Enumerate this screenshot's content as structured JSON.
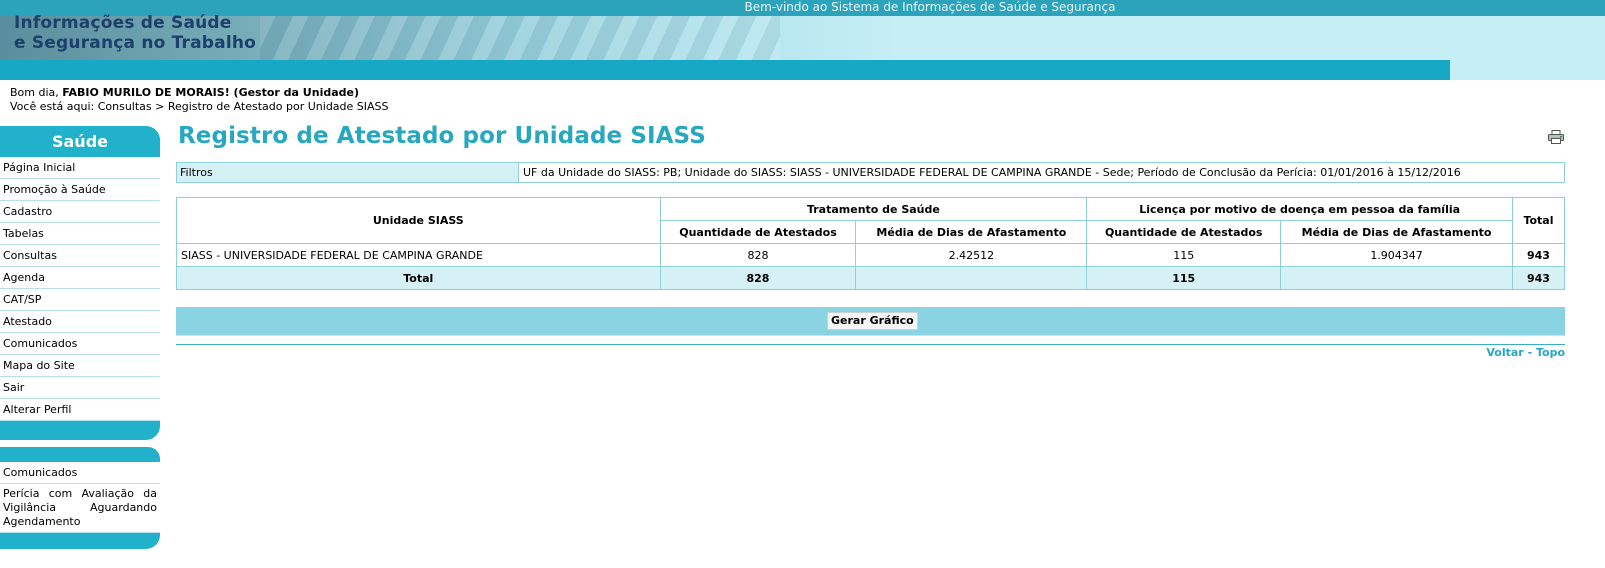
{
  "header": {
    "welcome": "Bem-vindo ao Sistema de Informações de Saúde e Segurança",
    "logo_line1": "Informações de Saúde",
    "logo_line2": "e Segurança no Trabalho"
  },
  "user": {
    "greeting_prefix": "Bom dia, ",
    "name": "FABIO MURILO DE MORAIS! (Gestor da Unidade)"
  },
  "breadcrumb": "Você está aqui: Consultas > Registro de Atestado por Unidade SIASS",
  "sidebar": {
    "title": "Saúde",
    "items": [
      {
        "label": "Página Inicial"
      },
      {
        "label": "Promoção à Saúde"
      },
      {
        "label": "Cadastro"
      },
      {
        "label": "Tabelas"
      },
      {
        "label": "Consultas"
      },
      {
        "label": "Agenda"
      },
      {
        "label": "CAT/SP"
      },
      {
        "label": "Atestado"
      },
      {
        "label": "Comunicados"
      },
      {
        "label": "Mapa do Site"
      },
      {
        "label": "Sair"
      },
      {
        "label": "Alterar Perfil"
      }
    ]
  },
  "sidebar2": {
    "items": [
      {
        "label": "Comunicados"
      },
      {
        "label": "Perícia com Avaliação da Vigilância Aguardando Agendamento"
      }
    ]
  },
  "page": {
    "title": "Registro de Atestado por Unidade SIASS"
  },
  "filters": {
    "label": "Filtros",
    "text": "UF da Unidade do SIASS: PB; Unidade do SIASS: SIASS - UNIVERSIDADE FEDERAL DE CAMPINA GRANDE - Sede; Período de Conclusão da Perícia: 01/01/2016 à 15/12/2016"
  },
  "table": {
    "col_unidade": "Unidade SIASS",
    "group1": "Tratamento de Saúde",
    "group2": "Licença por motivo de doença em pessoa da família",
    "col_total": "Total",
    "sub_qtd": "Quantidade de Atestados",
    "sub_media": "Média de Dias de Afastamento",
    "rows": [
      {
        "unidade": "SIASS - UNIVERSIDADE FEDERAL DE CAMPINA GRANDE",
        "qtd1": "828",
        "media1": "2.42512",
        "qtd2": "115",
        "media2": "1.904347",
        "total": "943"
      }
    ],
    "total_row": {
      "label": "Total",
      "qtd1": "828",
      "media1": "",
      "qtd2": "115",
      "media2": "",
      "total": "943"
    }
  },
  "buttons": {
    "gerar": "Gerar Gráfico"
  },
  "links": {
    "voltar": "Voltar",
    "sep": " - ",
    "topo": "Topo"
  },
  "colors": {
    "accent": "#27a8c0",
    "sidebar": "#21b1ca",
    "header_bar": "#16a8c4",
    "highlight_row": "#d6f1f6"
  }
}
